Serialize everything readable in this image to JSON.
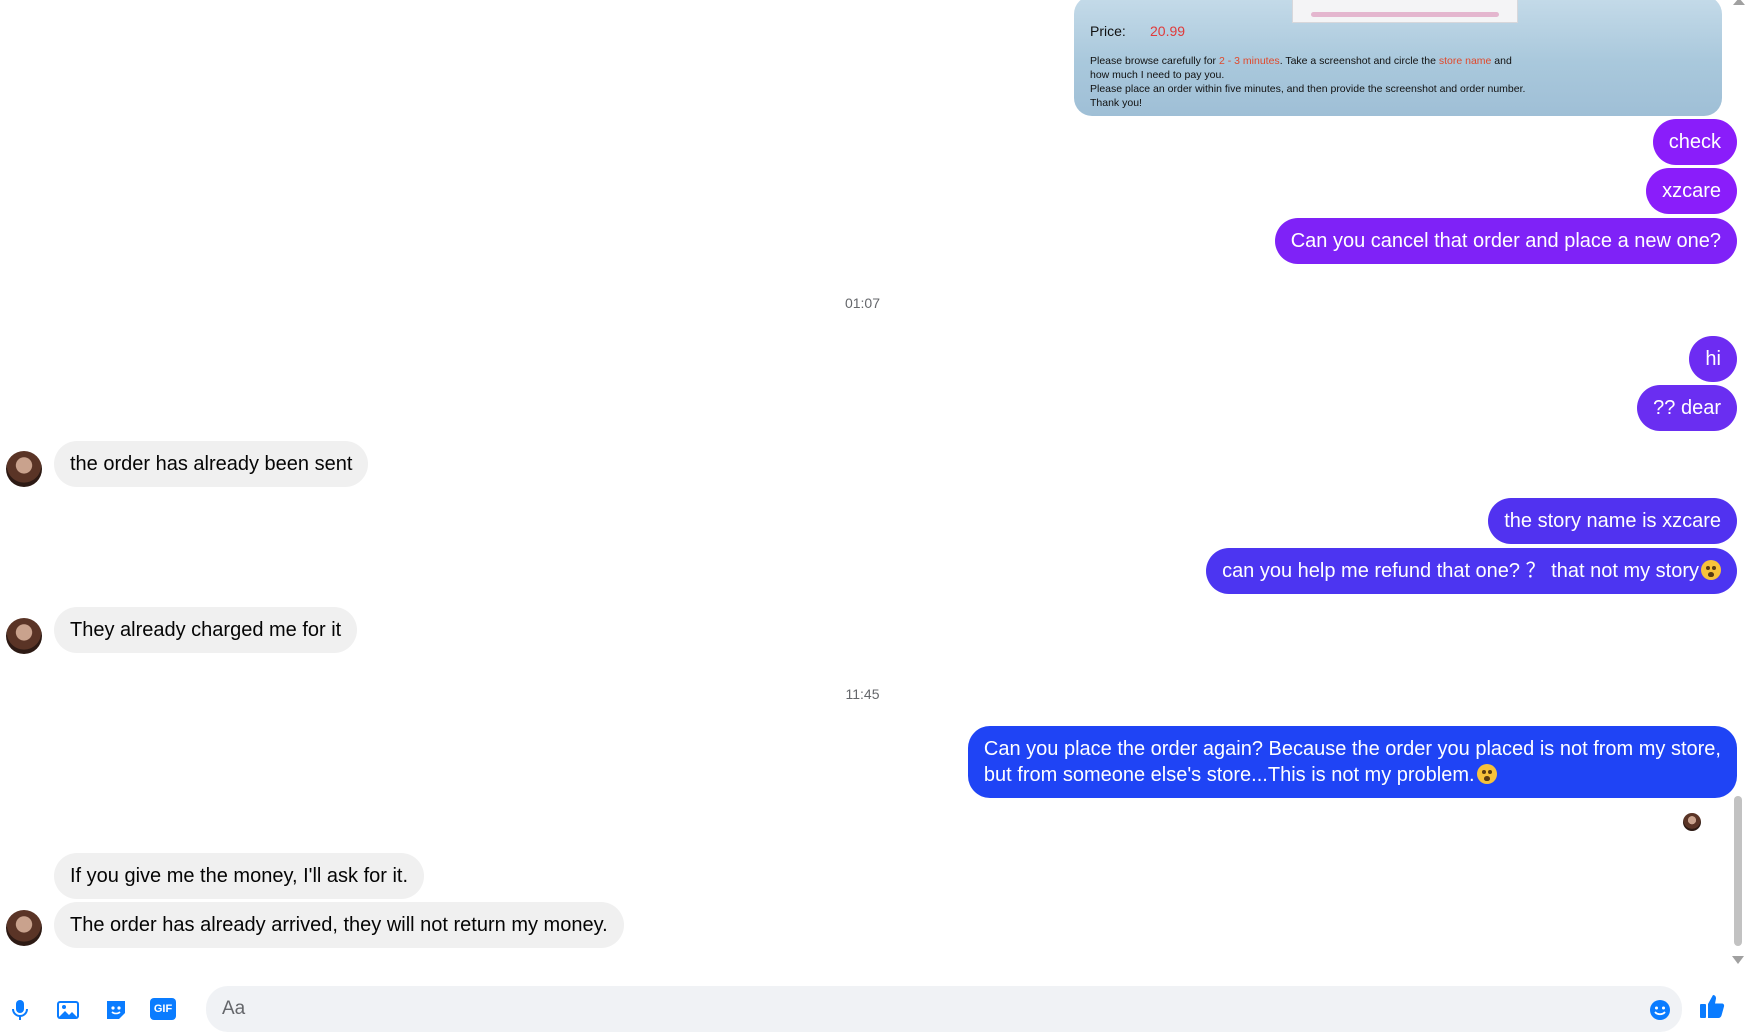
{
  "image_card": {
    "price_label": "Price:",
    "price_value": "20.99",
    "line1_pre": "Please browse carefully for ",
    "line1_red1": "2 - 3 minutes",
    "line1_mid": ". Take a screenshot and circle the ",
    "line1_red2": "store name",
    "line1_post": " and",
    "line2": "how much I need to pay you.",
    "line3": "Please place an order within five minutes, and then provide the screenshot and order number.",
    "line4": "Thank you!"
  },
  "messages": [
    {
      "text": "check"
    },
    {
      "text": "xzcare"
    },
    {
      "text": "Can you cancel that order and place a new one?"
    },
    {
      "text": "hi"
    },
    {
      "text": "?? dear"
    },
    {
      "text": "the order has already been sent"
    },
    {
      "text": "the story name is xzcare"
    },
    {
      "text": "can you help me refund that one? ？ that not my story"
    },
    {
      "text": "They already charged me for it"
    },
    {
      "text": "Can you place the order again? Because the order you placed is not from my store,"
    },
    {
      "text": "but from someone else's store...This is not my problem."
    },
    {
      "text": "If you give me the money, I'll ask for it."
    },
    {
      "text": "The order has already arrived, they will not return my money."
    }
  ],
  "timestamps": [
    "01:07",
    "11:45"
  ],
  "composer": {
    "placeholder": "Aa",
    "icons": [
      "microphone-icon",
      "photo-icon",
      "sticker-icon",
      "gif-icon",
      "emoji-icon",
      "like-icon"
    ],
    "gif_label": "GIF"
  },
  "colors": {
    "outgoing_purple": "#8a1dfa",
    "outgoing_violet": "#6b2ef0",
    "outgoing_blue": "#1f44f5",
    "incoming_gray": "#f0f0f0",
    "accent": "#0a7cff"
  }
}
